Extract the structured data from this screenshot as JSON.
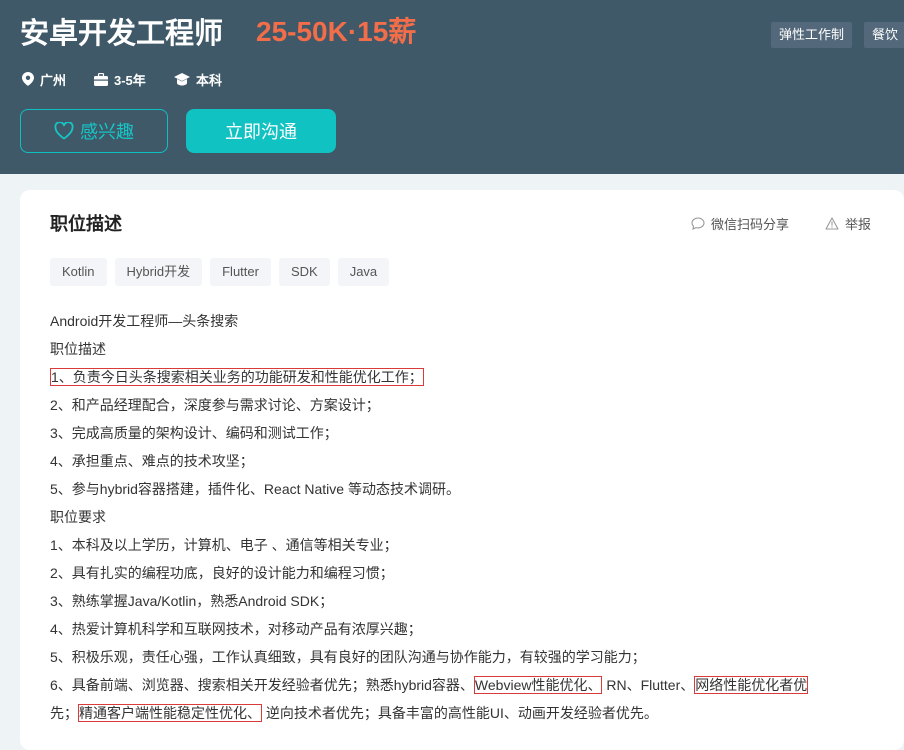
{
  "job": {
    "title": "安卓开发工程师",
    "salary": "25-50K·15薪",
    "benefits": [
      "弹性工作制",
      "餐饮"
    ],
    "location": "广州",
    "experience": "3-5年",
    "education": "本科"
  },
  "actions": {
    "interest_label": "感兴趣",
    "chat_label": "立即沟通"
  },
  "section": {
    "title": "职位描述",
    "share_label": "微信扫码分享",
    "report_label": "举报"
  },
  "tags": [
    "Kotlin",
    "Hybrid开发",
    "Flutter",
    "SDK",
    "Java"
  ],
  "description": {
    "l0": "Android开发工程师—头条搜索",
    "l1": "职位描述",
    "l2": "1、负责今日头条搜索相关业务的功能研发和性能优化工作；",
    "l3": "2、和产品经理配合，深度参与需求讨论、方案设计；",
    "l4": "3、完成高质量的架构设计、编码和测试工作；",
    "l5": "4、承担重点、难点的技术攻坚；",
    "l6": "5、参与hybrid容器搭建，插件化、React Native 等动态技术调研。",
    "l7": "职位要求",
    "l8": "1、本科及以上学历，计算机、电子 、通信等相关专业；",
    "l9": "2、具有扎实的编程功底，良好的设计能力和编程习惯；",
    "l10": "3、熟练掌握Java/Kotlin，熟悉Android SDK；",
    "l11": "4、热爱计算机科学和互联网技术，对移动产品有浓厚兴趣；",
    "l12": "5、积极乐观，责任心强，工作认真细致，具有良好的团队沟通与协作能力，有较强的学习能力；",
    "l13a": "6、具备前端、浏览器、搜索相关开发经验者优先；熟悉hybrid容器、",
    "l13b": "Webview性能优化、",
    "l13c": "RN、Flutter、",
    "l13d": "网络性能优化者优",
    "l14a": "先；",
    "l14b": "精通客户端性能稳定性优化、",
    "l14c": "逆向技术者优先；具备丰富的高性能UI、动画开发经验者优先。"
  },
  "colors": {
    "header_bg": "#3f5969",
    "salary": "#f26d49",
    "accent": "#10c2c2",
    "highlight_border": "#d93a3a"
  }
}
